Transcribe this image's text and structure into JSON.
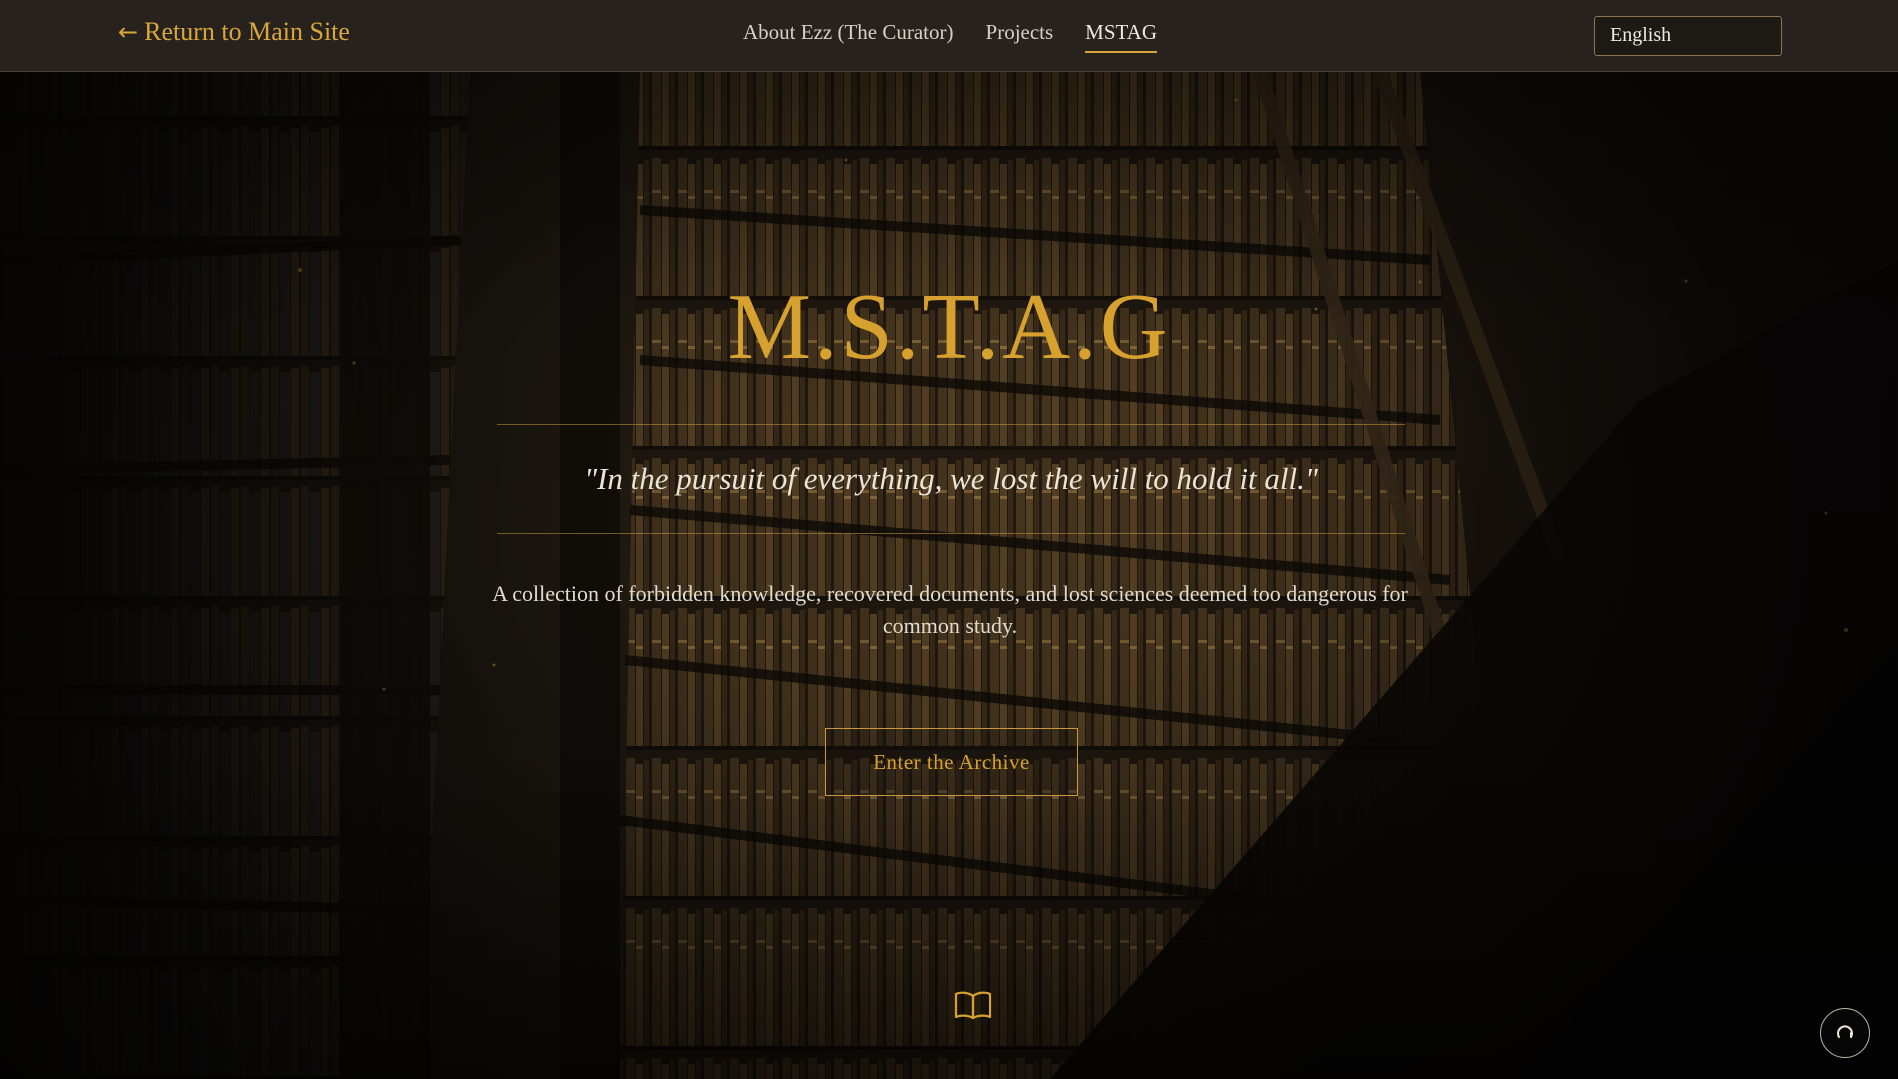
{
  "header": {
    "back_arrow": "←",
    "back_label": "Return to Main Site",
    "nav": [
      {
        "label": "About Ezz (The Curator)",
        "active": false
      },
      {
        "label": "Projects",
        "active": false
      },
      {
        "label": "MSTAG",
        "active": true
      }
    ],
    "language": "English"
  },
  "hero": {
    "title": "M.S.T.A.G",
    "quote": "\"In the pursuit of everything, we lost the will to hold it all.\"",
    "description": "A collection of forbidden knowledge, recovered documents, and lost sciences deemed too dangerous for common study.",
    "cta_label": "Enter the Archive"
  },
  "icons": {
    "scroll_hint": "book-open-icon",
    "floating_button": "refresh-icon"
  },
  "colors": {
    "accent": "#d6a12e",
    "header_bg": "#27221d",
    "text_light": "#e2dace"
  }
}
